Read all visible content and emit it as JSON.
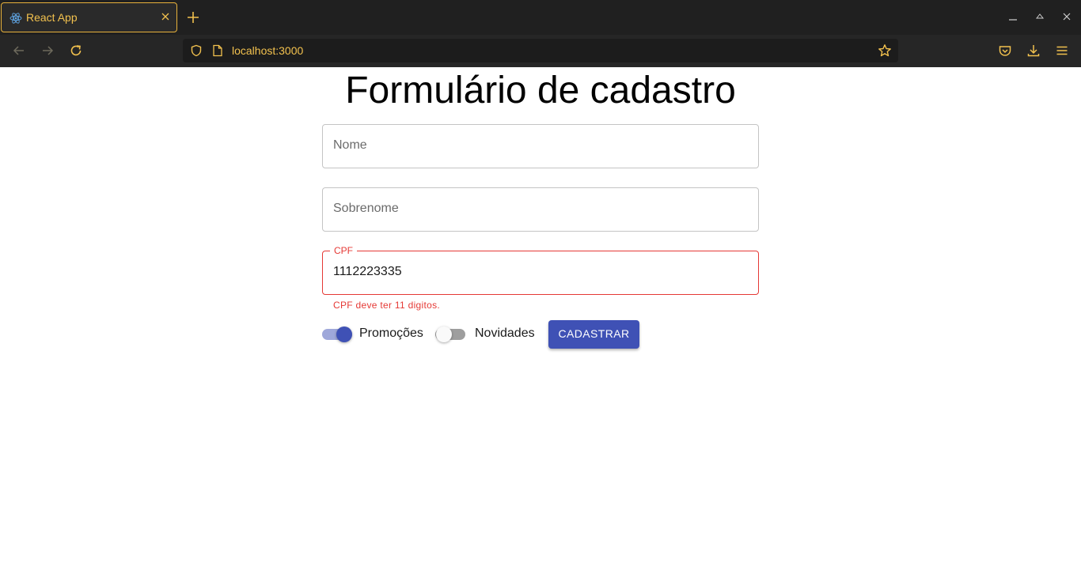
{
  "browser": {
    "tab_title": "React App",
    "url": "localhost:3000",
    "accent": "#f2c14e"
  },
  "icons": {
    "tab": "react-icon",
    "close": "close-icon",
    "new_tab": "plus-icon",
    "back": "arrow-left-icon",
    "forward": "arrow-right-icon",
    "reload": "reload-icon",
    "shield": "shield-icon",
    "page": "page-icon",
    "bookmark": "star-icon",
    "pocket": "pocket-icon",
    "downloads": "download-icon",
    "menu": "hamburger-icon"
  },
  "form": {
    "title": "Formulário de cadastro",
    "nome_placeholder": "Nome",
    "sobrenome_placeholder": "Sobrenome",
    "cpf_label": "CPF",
    "cpf_value": "1112223335",
    "cpf_error": "CPF deve ter 11 digitos.",
    "promocoes_label": "Promoções",
    "promocoes_on": true,
    "novidades_label": "Novidades",
    "novidades_on": false,
    "submit_label": "CADASTRAR"
  },
  "colors": {
    "primary": "#3f51b5",
    "error": "#e53935"
  }
}
